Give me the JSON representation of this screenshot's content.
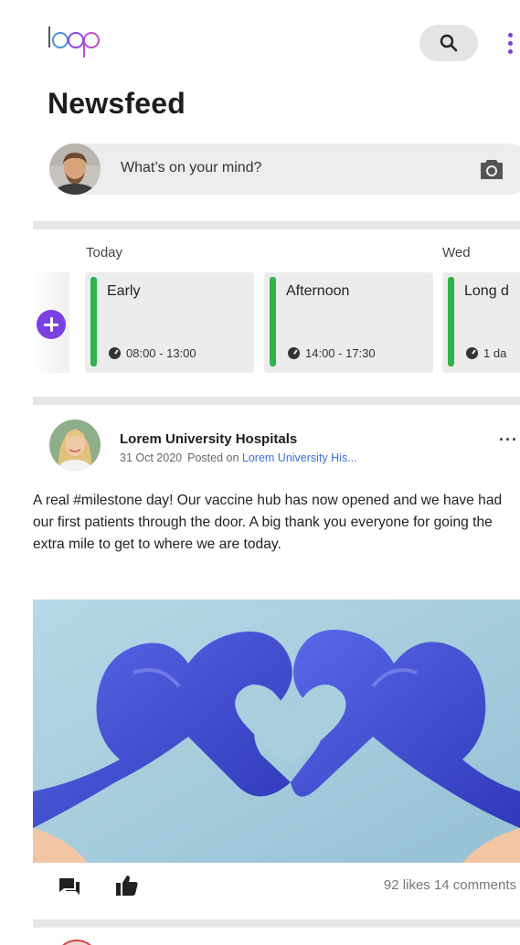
{
  "header": {
    "logo_text": "loop",
    "search_icon": "search-icon",
    "more_icon": "more-vertical-icon",
    "accent_color": "#7b3fe4"
  },
  "page_title": "Newsfeed",
  "composer": {
    "placeholder": "What’s on your mind?",
    "camera_icon": "camera-icon"
  },
  "shifts": {
    "days": [
      "Today",
      "Wed"
    ],
    "add_icon": "add-icon",
    "items": [
      {
        "name": "Early",
        "time": "08:00 - 13:00",
        "status_color": "#2fb24c"
      },
      {
        "name": "Afternoon",
        "time": "14:00 - 17:30",
        "status_color": "#2fb24c"
      },
      {
        "name": "Long d",
        "time": "1 da",
        "status_color": "#2fb24c"
      }
    ]
  },
  "post": {
    "author": "Lorem University Hospitals",
    "date": "31 Oct 2020",
    "posted_on_label": "Posted on",
    "posted_on_link": "Lorem University His...",
    "more_label": "···",
    "text": "A real #milestone day! Our vaccine hub has now opened and we have had our first patients through the door. A big thank you everyone for going the extra mile to get to where we are today.",
    "likes": "92 likes",
    "comments": "14 comments",
    "comment_icon": "comment-icon",
    "like_icon": "thumbs-up-icon"
  }
}
